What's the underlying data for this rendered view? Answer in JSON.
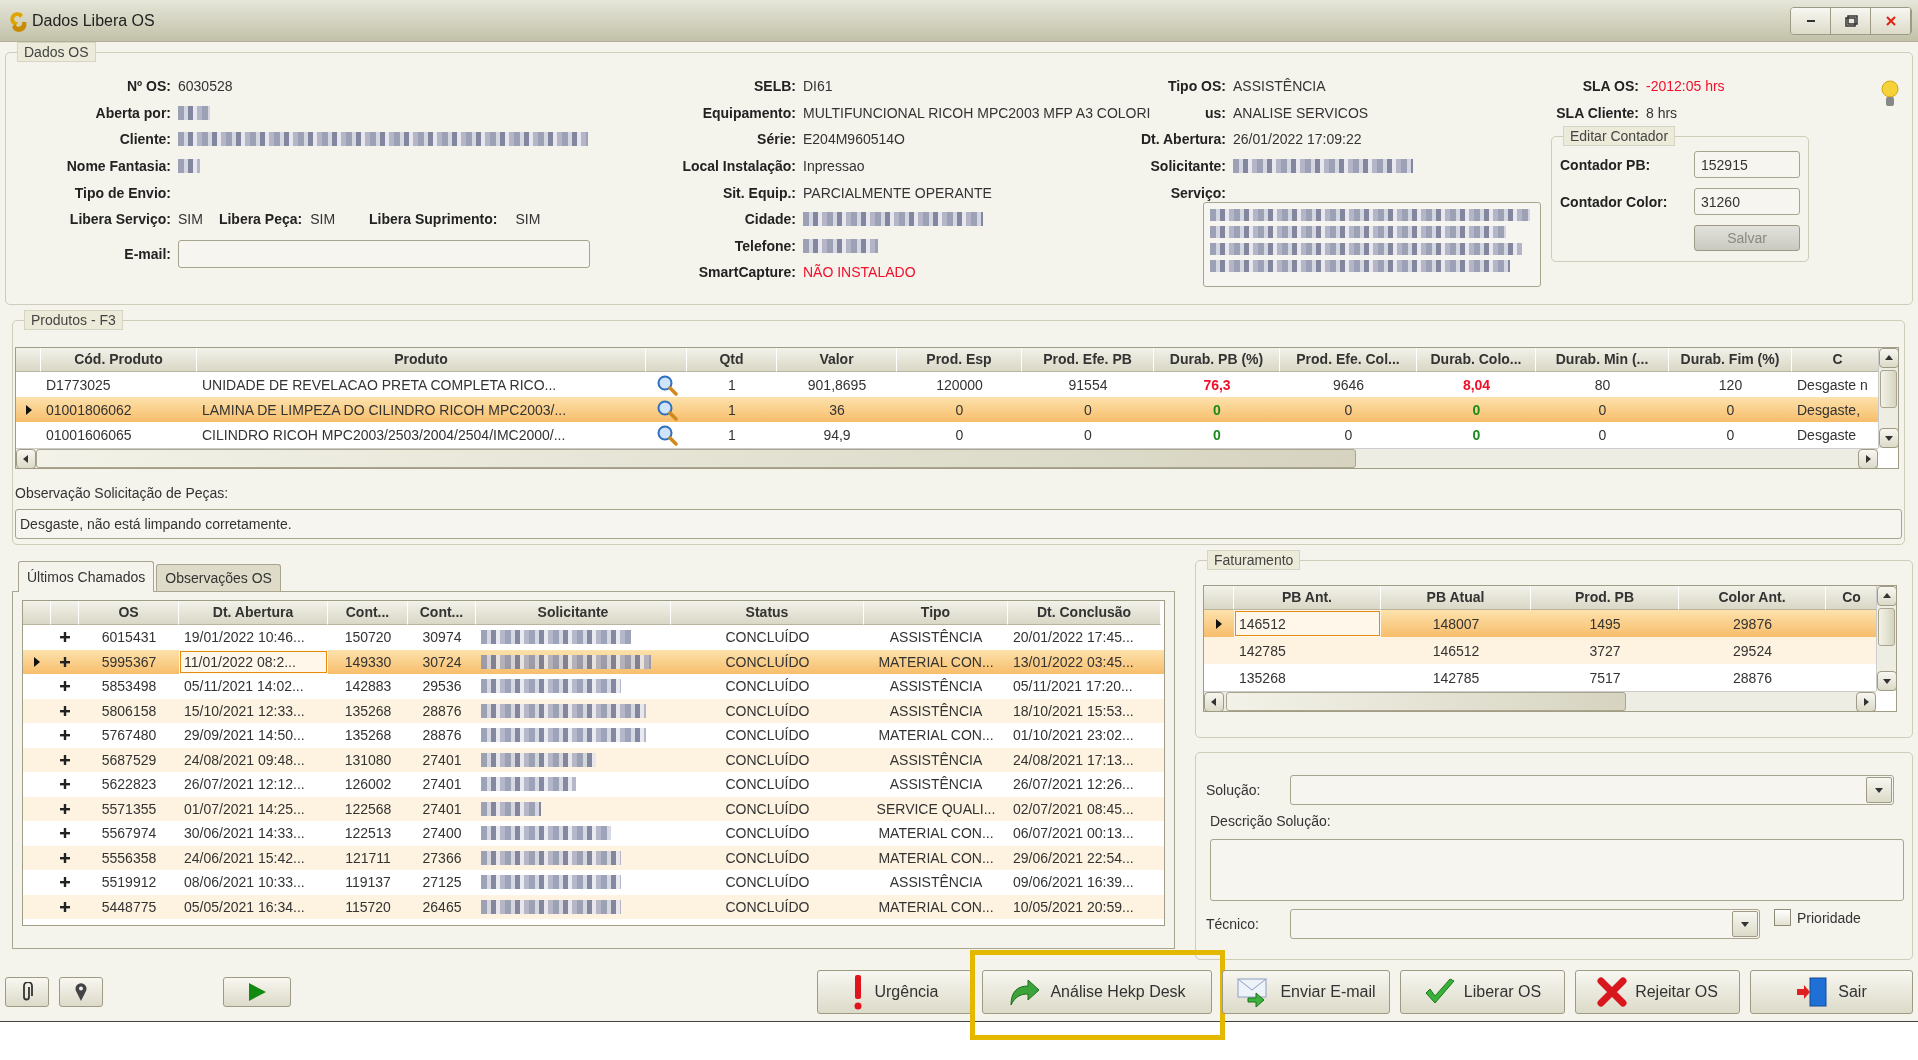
{
  "window": {
    "title": "Dados Libera OS"
  },
  "dados_os": {
    "legend": "Dados OS",
    "col1": [
      {
        "label": "Nº OS:",
        "kind": "text",
        "value": "6030528"
      },
      {
        "label": "Aberta por:",
        "kind": "redacted"
      },
      {
        "label": "Cliente:",
        "kind": "redacted"
      },
      {
        "label": "Nome Fantasia:",
        "kind": "redacted"
      },
      {
        "label": "Tipo de Envio:",
        "kind": "label"
      }
    ],
    "libera": [
      {
        "label": "Libera Serviço:",
        "value": "SIM"
      },
      {
        "label": "Libera Peça:",
        "value": "SIM"
      },
      {
        "label": "Libera Suprimento:",
        "value": "SIM"
      }
    ],
    "email": {
      "label": "E-mail:"
    },
    "col2": [
      {
        "label": "SELB:",
        "kind": "text",
        "value": "DI61"
      },
      {
        "label": "Equipamento:",
        "kind": "text",
        "value": "MULTIFUNCIONAL RICOH MPC2003 MFP A3 COLORI"
      },
      {
        "label": "Série:",
        "kind": "text",
        "value": "E204M960514O"
      },
      {
        "label": "Local Instalação:",
        "kind": "text",
        "value": "Inpressao"
      },
      {
        "label": "Sit. Equip.:",
        "kind": "text",
        "value": "PARCIALMENTE OPERANTE"
      },
      {
        "label": "Cidade:",
        "kind": "redacted"
      },
      {
        "label": "Telefone:",
        "kind": "redacted"
      },
      {
        "label": "SmartCapture:",
        "kind": "alert_text",
        "value": "NÃO INSTALADO"
      }
    ],
    "col3": [
      {
        "label": "Tipo OS:",
        "kind": "text",
        "value": "ASSISTÊNCIA"
      },
      {
        "label": "us:",
        "kind": "text",
        "value": "ANALISE SERVICOS"
      },
      {
        "label": "Dt. Abertura:",
        "kind": "text",
        "value": "26/01/2022 17:09:22"
      },
      {
        "label": "Solicitante:",
        "kind": "redacted"
      },
      {
        "label": "Serviço:",
        "kind": "memo"
      }
    ],
    "sla": [
      {
        "label": "SLA OS:",
        "value": "-2012:05 hrs",
        "alert": true
      },
      {
        "label": "SLA Cliente:",
        "value": "8 hrs",
        "alert": false
      }
    ]
  },
  "contador": {
    "legend": "Editar Contador",
    "fields": [
      {
        "label": "Contador PB:",
        "value": "152915"
      },
      {
        "label": "Contador Color:",
        "value": "31260"
      }
    ],
    "button": {
      "label": "Salvar",
      "disabled": true
    }
  },
  "produtos": {
    "legend": "Produtos - F3",
    "columns": [
      "Cód. Produto",
      "Produto",
      "Qtd",
      "Valor",
      "Prod. Esp",
      "Prod. Efe. PB",
      "Durab. PB (%)",
      "Prod. Efe. Col...",
      "Durab. Colo...",
      "Durab. Min (...",
      "Durab. Fim (%)",
      "C"
    ],
    "rows": [
      {
        "cells": [
          "D1773025",
          "UNIDADE DE REVELACAO PRETA COMPLETA RICO...",
          "1",
          "901,8695",
          "120000",
          "91554",
          "76,3",
          "9646",
          "8,04",
          "80",
          "120",
          "Desgaste n"
        ],
        "selected": false,
        "alert": true
      },
      {
        "cells": [
          "01001806062",
          "LAMINA DE LIMPEZA DO CILINDRO RICOH MPC2003/...",
          "1",
          "36",
          "0",
          "0",
          "0",
          "0",
          "0",
          "0",
          "0",
          "Desgaste,"
        ],
        "selected": true,
        "alert": false
      },
      {
        "cells": [
          "01001606065",
          "CILINDRO RICOH MPC2003/2503/2004/2504/IMC2000/...",
          "1",
          "94,9",
          "0",
          "0",
          "0",
          "0",
          "0",
          "0",
          "0",
          "Desgaste"
        ],
        "selected": false,
        "alert": false
      }
    ],
    "obs_label": "Observação Solicitação de Peças:",
    "obs_value": "Desgaste, não está limpando corretamente."
  },
  "tabs": [
    {
      "label": "Últimos Chamados",
      "selected": true
    },
    {
      "label": "Observações OS",
      "selected": false
    }
  ],
  "chamados": {
    "columns": [
      {
        "label": "OS",
        "kind": "text"
      },
      {
        "label": "Dt. Abertura",
        "kind": "text"
      },
      {
        "label": "Cont...",
        "kind": "text"
      },
      {
        "label": "Cont...",
        "kind": "text"
      },
      {
        "label": "Solicitante",
        "kind": "redacted"
      },
      {
        "label": "Status",
        "kind": "text"
      },
      {
        "label": "Tipo",
        "kind": "text"
      },
      {
        "label": "Dt. Conclusão",
        "kind": "text"
      }
    ],
    "rows": [
      {
        "cells": [
          "6015431",
          "19/01/2022 10:46...",
          "150720",
          "30974",
          "",
          "CONCLUÍDO",
          "ASSISTÊNCIA",
          "20/01/2022 17:45..."
        ],
        "selected": false,
        "expanded": false
      },
      {
        "cells": [
          "5995367",
          "11/01/2022 08:2...",
          "149330",
          "30724",
          "",
          "CONCLUÍDO",
          "MATERIAL CON...",
          "13/01/2022 03:45..."
        ],
        "selected": true,
        "expanded": false
      },
      {
        "cells": [
          "5853498",
          "05/11/2021 14:02...",
          "142883",
          "29536",
          "",
          "CONCLUÍDO",
          "ASSISTÊNCIA",
          "05/11/2021 17:20..."
        ],
        "selected": false,
        "expanded": false
      },
      {
        "cells": [
          "5806158",
          "15/10/2021 12:33...",
          "135268",
          "28876",
          "",
          "CONCLUÍDO",
          "ASSISTÊNCIA",
          "18/10/2021 15:53..."
        ],
        "selected": false,
        "expanded": false
      },
      {
        "cells": [
          "5767480",
          "29/09/2021 14:50...",
          "135268",
          "28876",
          "",
          "CONCLUÍDO",
          "MATERIAL CON...",
          "01/10/2021 23:02..."
        ],
        "selected": false,
        "expanded": false
      },
      {
        "cells": [
          "5687529",
          "24/08/2021 09:48...",
          "131080",
          "27401",
          "",
          "CONCLUÍDO",
          "ASSISTÊNCIA",
          "24/08/2021 17:13..."
        ],
        "selected": false,
        "expanded": false
      },
      {
        "cells": [
          "5622823",
          "26/07/2021 12:12...",
          "126002",
          "27401",
          "",
          "CONCLUÍDO",
          "ASSISTÊNCIA",
          "26/07/2021 12:26..."
        ],
        "selected": false,
        "expanded": false
      },
      {
        "cells": [
          "5571355",
          "01/07/2021 14:25...",
          "122568",
          "27401",
          "",
          "CONCLUÍDO",
          "SERVICE QUALI...",
          "02/07/2021 08:45..."
        ],
        "selected": false,
        "expanded": false
      },
      {
        "cells": [
          "5567974",
          "30/06/2021 14:33...",
          "122513",
          "27400",
          "",
          "CONCLUÍDO",
          "MATERIAL CON...",
          "06/07/2021 00:13..."
        ],
        "selected": false,
        "expanded": false
      },
      {
        "cells": [
          "5556358",
          "24/06/2021 15:42...",
          "121711",
          "27366",
          "",
          "CONCLUÍDO",
          "MATERIAL CON...",
          "29/06/2021 22:54..."
        ],
        "selected": false,
        "expanded": false
      },
      {
        "cells": [
          "5519912",
          "08/06/2021 10:33...",
          "119137",
          "27125",
          "",
          "CONCLUÍDO",
          "ASSISTÊNCIA",
          "09/06/2021 16:39..."
        ],
        "selected": false,
        "expanded": false
      },
      {
        "cells": [
          "5448775",
          "05/05/2021 16:34...",
          "115720",
          "26465",
          "",
          "CONCLUÍDO",
          "MATERIAL CON...",
          "10/05/2021 20:59..."
        ],
        "selected": false,
        "expanded": false
      }
    ]
  },
  "faturamento": {
    "legend": "Faturamento",
    "columns": [
      "PB Ant.",
      "PB Atual",
      "Prod. PB",
      "Color Ant.",
      "Co"
    ],
    "rows": [
      {
        "cells": [
          "146512",
          "148007",
          "1495",
          "29876"
        ],
        "selected": true
      },
      {
        "cells": [
          "142785",
          "146512",
          "3727",
          "29524"
        ],
        "selected": false
      },
      {
        "cells": [
          "135268",
          "142785",
          "7517",
          "28876"
        ],
        "selected": false
      }
    ]
  },
  "solucao": {
    "solucao_label": "Solução:",
    "descricao_label": "Descrição Solução:",
    "tecnico_label": "Técnico:",
    "prioridade": {
      "label": "Prioridade",
      "checked": false
    }
  },
  "left_tools": [
    {
      "kind": "clip"
    },
    {
      "kind": "pin"
    },
    {
      "kind": "play"
    }
  ],
  "buttons": [
    {
      "label": "Urgência",
      "kind": "urgent",
      "highlighted": false
    },
    {
      "label": "Análise Hekp Desk",
      "kind": "forward",
      "highlighted": true
    },
    {
      "label": "Enviar E-mail",
      "kind": "mail",
      "highlighted": false
    },
    {
      "label": "Liberar OS",
      "kind": "check",
      "highlighted": false
    },
    {
      "label": "Rejeitar OS",
      "kind": "reject",
      "highlighted": false
    },
    {
      "label": "Sair",
      "kind": "exit",
      "highlighted": false
    }
  ]
}
